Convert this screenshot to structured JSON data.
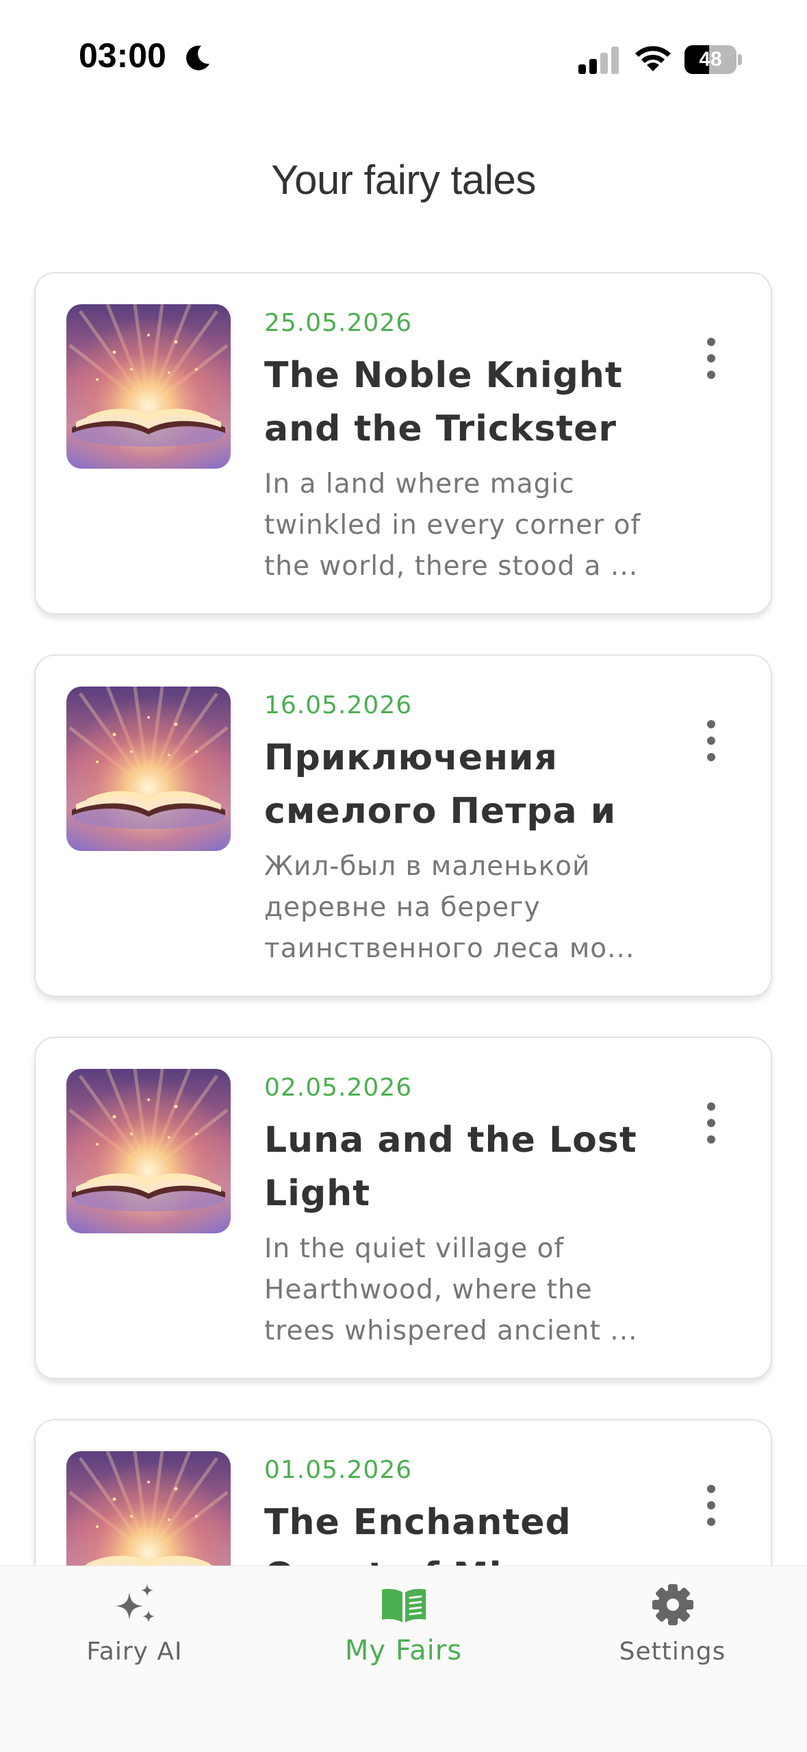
{
  "status_bar": {
    "time": "03:00",
    "battery": "48",
    "battery_level": 0.48
  },
  "page": {
    "title": "Your fairy tales"
  },
  "tales": [
    {
      "date": "25.05.2026",
      "title": "The Noble Knight and the Trickster ...",
      "excerpt": "In a land where magic twinkled in every corner of the world, there stood a ..."
    },
    {
      "date": "16.05.2026",
      "title": "Приключения смелого Петра и ...",
      "excerpt": "Жил-был в маленькой деревне на берегу таинственного леса мо..."
    },
    {
      "date": "02.05.2026",
      "title": "Luna and the Lost Light",
      "excerpt": "In the quiet village of Hearthwood, where the trees whispered ancient ..."
    },
    {
      "date": "01.05.2026",
      "title": "The Enchanted Quest of Mira",
      "excerpt": ""
    }
  ],
  "nav": {
    "items": [
      {
        "label": "Fairy AI",
        "icon": "sparkles-icon"
      },
      {
        "label": "My Fairs",
        "icon": "open-book-icon"
      },
      {
        "label": "Settings",
        "icon": "gear-icon"
      }
    ],
    "active_index": 1
  },
  "colors": {
    "accent": "#4caf50",
    "text": "#333333",
    "muted": "#777777"
  }
}
